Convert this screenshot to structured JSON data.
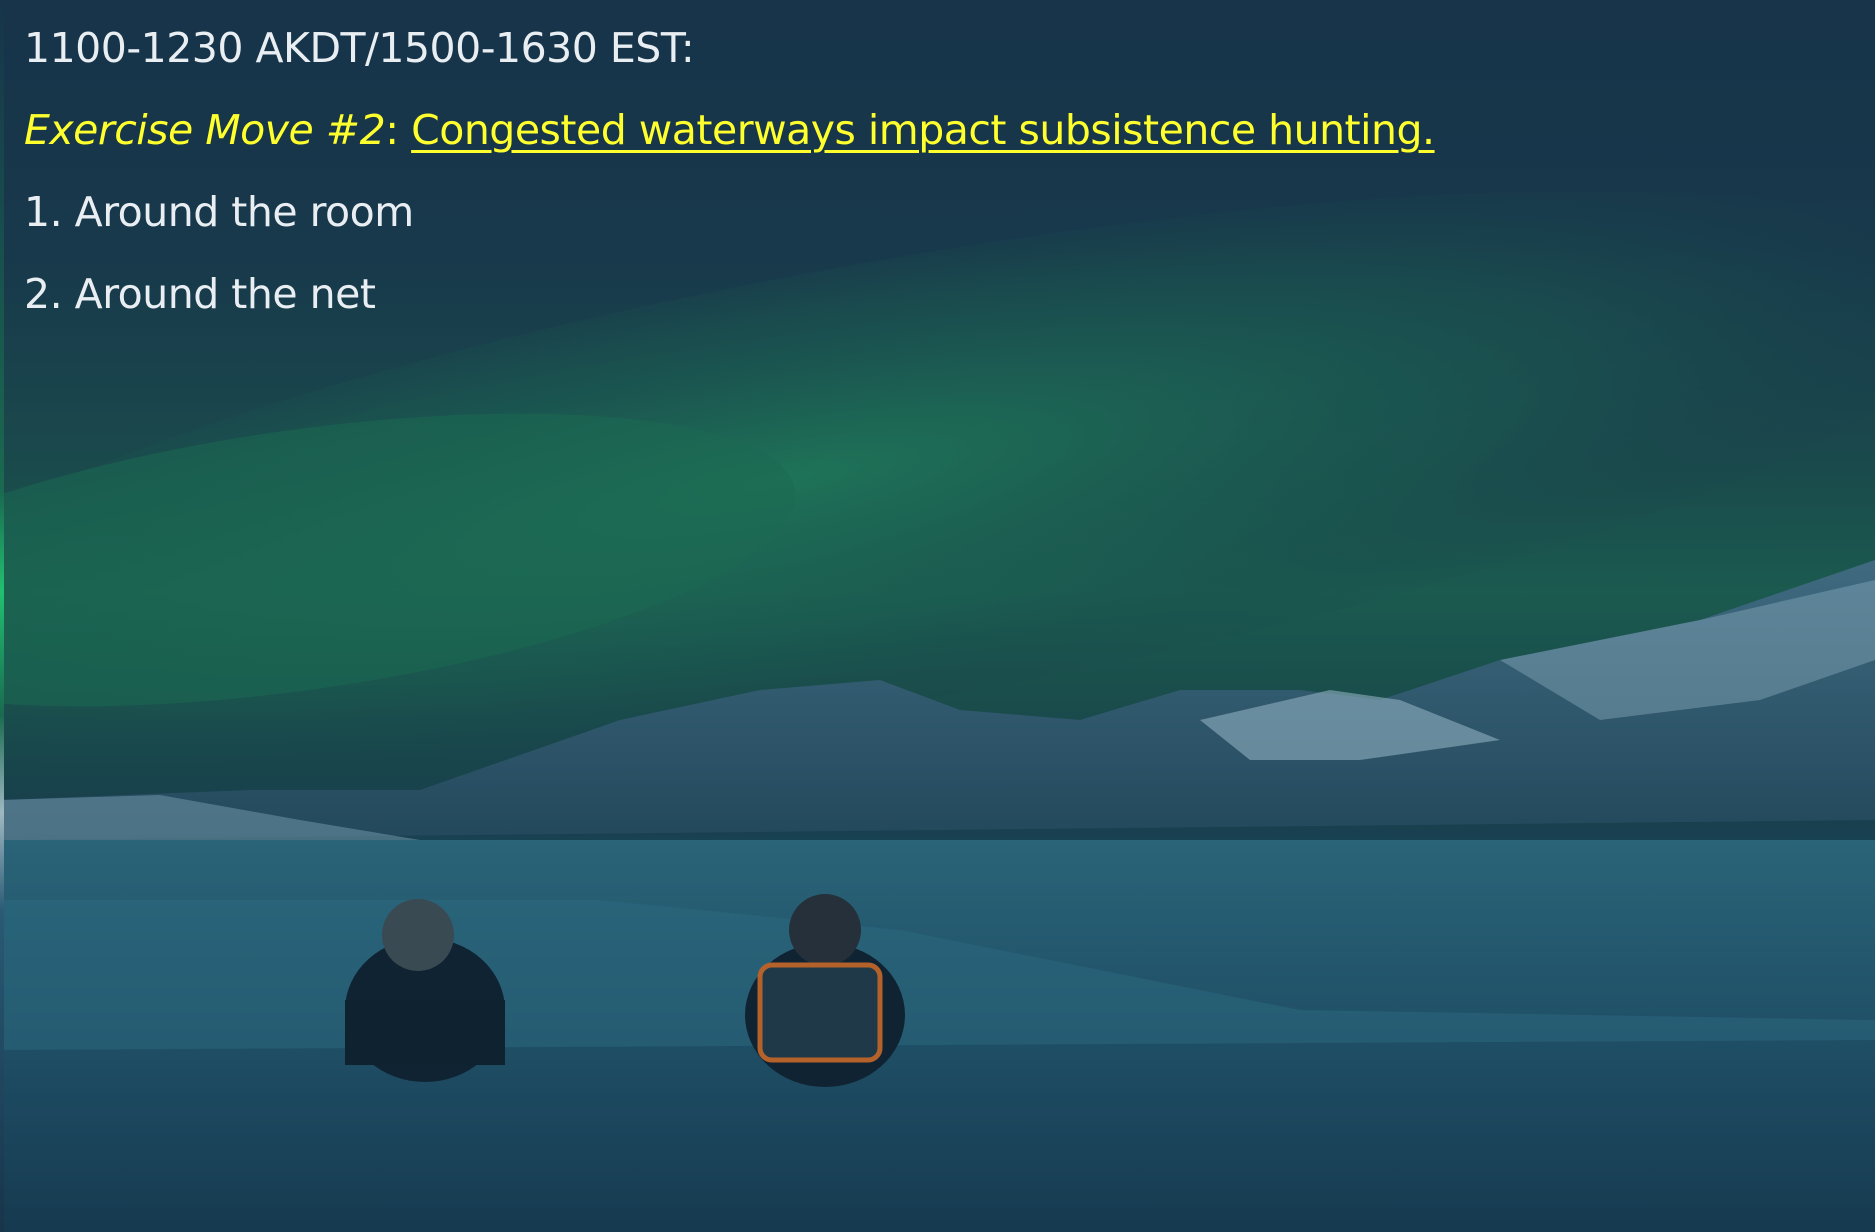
{
  "slide": {
    "time_line": "1100-1230 AKDT/1500-1630 EST:",
    "move_label": "Exercise Move #2",
    "separator": ":",
    "move_topic": "Congested waterways impact subsistence hunting.",
    "items": [
      {
        "number": "1.",
        "text": "Around the room"
      },
      {
        "number": "2.",
        "text": "Around the net"
      }
    ]
  },
  "background": {
    "description_icon": "aurora-landscape-image",
    "accent_text_color": "#ffff2e",
    "body_text_color": "#e9eef2"
  }
}
